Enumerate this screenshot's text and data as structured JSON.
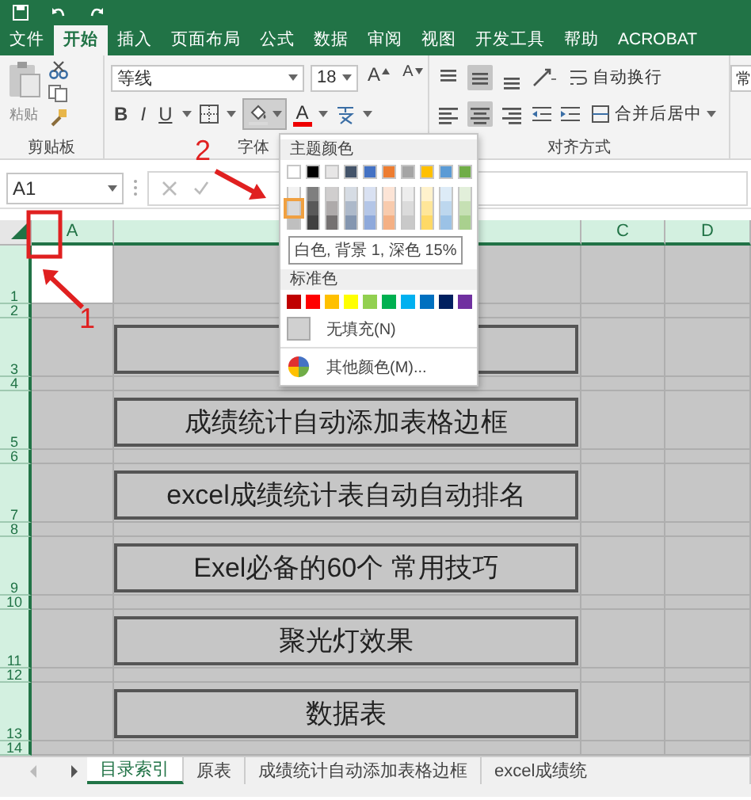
{
  "menu_tabs": [
    {
      "label": "文件",
      "selected": false
    },
    {
      "label": "开始",
      "selected": true
    },
    {
      "label": "插入",
      "selected": false
    },
    {
      "label": "页面布局",
      "selected": false
    },
    {
      "label": "公式",
      "selected": false
    },
    {
      "label": "数据",
      "selected": false
    },
    {
      "label": "审阅",
      "selected": false
    },
    {
      "label": "视图",
      "selected": false
    },
    {
      "label": "开发工具",
      "selected": false
    },
    {
      "label": "帮助",
      "selected": false
    },
    {
      "label": "ACROBAT",
      "selected": false
    }
  ],
  "clipboard": {
    "paste_label": "粘贴",
    "group_label": "剪贴板"
  },
  "font": {
    "font_name": "等线",
    "font_size": "18",
    "grow_label": "A",
    "shrink_label": "A",
    "format_buttons": [
      "B",
      "I",
      "U"
    ],
    "fill_expanded": true,
    "font_color_label": "A",
    "group_label": "字体"
  },
  "alignment": {
    "vertical": [
      {
        "selected": false
      },
      {
        "selected": true
      },
      {
        "selected": false
      }
    ],
    "horizontal": [
      {
        "selected": false
      },
      {
        "selected": true
      },
      {
        "selected": false
      }
    ],
    "wrap_label": "自动换行",
    "merge_label": "合并后居中",
    "group_label": "对齐方式"
  },
  "number_format": "常",
  "formula_bar": {
    "name_box": "A1"
  },
  "column_headers": {
    "a": "A",
    "c": "C",
    "d": "D"
  },
  "rows": [
    {
      "number": "1",
      "kind": "tall",
      "a_selected": true,
      "box": false
    },
    {
      "number": "2",
      "kind": "short",
      "a_selected": false,
      "box": false
    },
    {
      "number": "3",
      "kind": "tall",
      "a_selected": false,
      "box": true
    },
    {
      "number": "4",
      "kind": "short",
      "a_selected": false,
      "box": false
    },
    {
      "number": "5",
      "kind": "tall",
      "a_selected": false,
      "box": true,
      "label": "成绩统计自动添加表格边框"
    },
    {
      "number": "6",
      "kind": "short",
      "a_selected": false,
      "box": false
    },
    {
      "number": "7",
      "kind": "tall",
      "a_selected": false,
      "box": true,
      "label": "excel成绩统计表自动自动排名"
    },
    {
      "number": "8",
      "kind": "short",
      "a_selected": false,
      "box": false
    },
    {
      "number": "9",
      "kind": "tall",
      "a_selected": false,
      "box": true,
      "label": "Exel必备的60个 常用技巧"
    },
    {
      "number": "10",
      "kind": "short",
      "a_selected": false,
      "box": false
    },
    {
      "number": "11",
      "kind": "tall",
      "a_selected": false,
      "box": true,
      "label": "聚光灯效果"
    },
    {
      "number": "12",
      "kind": "short",
      "a_selected": false,
      "box": false
    },
    {
      "number": "13",
      "kind": "tall",
      "a_selected": false,
      "box": true,
      "label": "数据表"
    },
    {
      "number": "14",
      "kind": "short",
      "a_selected": false,
      "box": false
    }
  ],
  "sheet_tabs": [
    {
      "label": "目录索引",
      "selected": true
    },
    {
      "label": "原表",
      "selected": false
    },
    {
      "label": "成绩统计自动添加表格边框",
      "selected": false
    },
    {
      "label": "excel成绩统",
      "selected": false
    }
  ],
  "color_menu": {
    "theme_title": "主题颜色",
    "theme": [
      {
        "color": "#ffffff",
        "shades": [
          {
            "color": "#f2f2f2",
            "selected": false
          },
          {
            "color": "#d9d9d9",
            "selected": true
          },
          {
            "color": "#bfbfbf",
            "selected": false
          }
        ]
      },
      {
        "color": "#000000",
        "shades": [
          {
            "color": "#7f7f7f",
            "selected": false
          },
          {
            "color": "#595959",
            "selected": false
          },
          {
            "color": "#404040",
            "selected": false
          }
        ]
      },
      {
        "color": "#e7e6e6",
        "shades": [
          {
            "color": "#d0cece",
            "selected": false
          },
          {
            "color": "#aeaaaa",
            "selected": false
          },
          {
            "color": "#757171",
            "selected": false
          }
        ]
      },
      {
        "color": "#44546a",
        "shades": [
          {
            "color": "#d6dce4",
            "selected": false
          },
          {
            "color": "#adb9ca",
            "selected": false
          },
          {
            "color": "#8496b0",
            "selected": false
          }
        ]
      },
      {
        "color": "#4472c4",
        "shades": [
          {
            "color": "#d9e1f2",
            "selected": false
          },
          {
            "color": "#b4c6e7",
            "selected": false
          },
          {
            "color": "#8ea9db",
            "selected": false
          }
        ]
      },
      {
        "color": "#ed7d31",
        "shades": [
          {
            "color": "#fce4d6",
            "selected": false
          },
          {
            "color": "#f8cbad",
            "selected": false
          },
          {
            "color": "#f4b084",
            "selected": false
          }
        ]
      },
      {
        "color": "#a5a5a5",
        "shades": [
          {
            "color": "#ededed",
            "selected": false
          },
          {
            "color": "#dbdbdb",
            "selected": false
          },
          {
            "color": "#c9c9c9",
            "selected": false
          }
        ]
      },
      {
        "color": "#ffc000",
        "shades": [
          {
            "color": "#fff2cc",
            "selected": false
          },
          {
            "color": "#ffe699",
            "selected": false
          },
          {
            "color": "#ffd966",
            "selected": false
          }
        ]
      },
      {
        "color": "#5b9bd5",
        "shades": [
          {
            "color": "#ddebf7",
            "selected": false
          },
          {
            "color": "#bdd7ee",
            "selected": false
          },
          {
            "color": "#9bc2e6",
            "selected": false
          }
        ]
      },
      {
        "color": "#70ad47",
        "shades": [
          {
            "color": "#e2efda",
            "selected": false
          },
          {
            "color": "#c6e0b4",
            "selected": false
          },
          {
            "color": "#a9d08e",
            "selected": false
          }
        ]
      }
    ],
    "tooltip": "白色, 背景 1, 深色 15%",
    "standard_title": "标准色",
    "standard": [
      {
        "color": "#c00000"
      },
      {
        "color": "#ff0000"
      },
      {
        "color": "#ffc000"
      },
      {
        "color": "#ffff00"
      },
      {
        "color": "#92d050"
      },
      {
        "color": "#00b050"
      },
      {
        "color": "#00b0f0"
      },
      {
        "color": "#0070c0"
      },
      {
        "color": "#002060"
      },
      {
        "color": "#7030a0"
      }
    ],
    "no_fill": "无填充(N)",
    "more_colors": "其他颜色(M)..."
  },
  "annotations": [
    {
      "label": "1"
    },
    {
      "label": "2"
    }
  ]
}
